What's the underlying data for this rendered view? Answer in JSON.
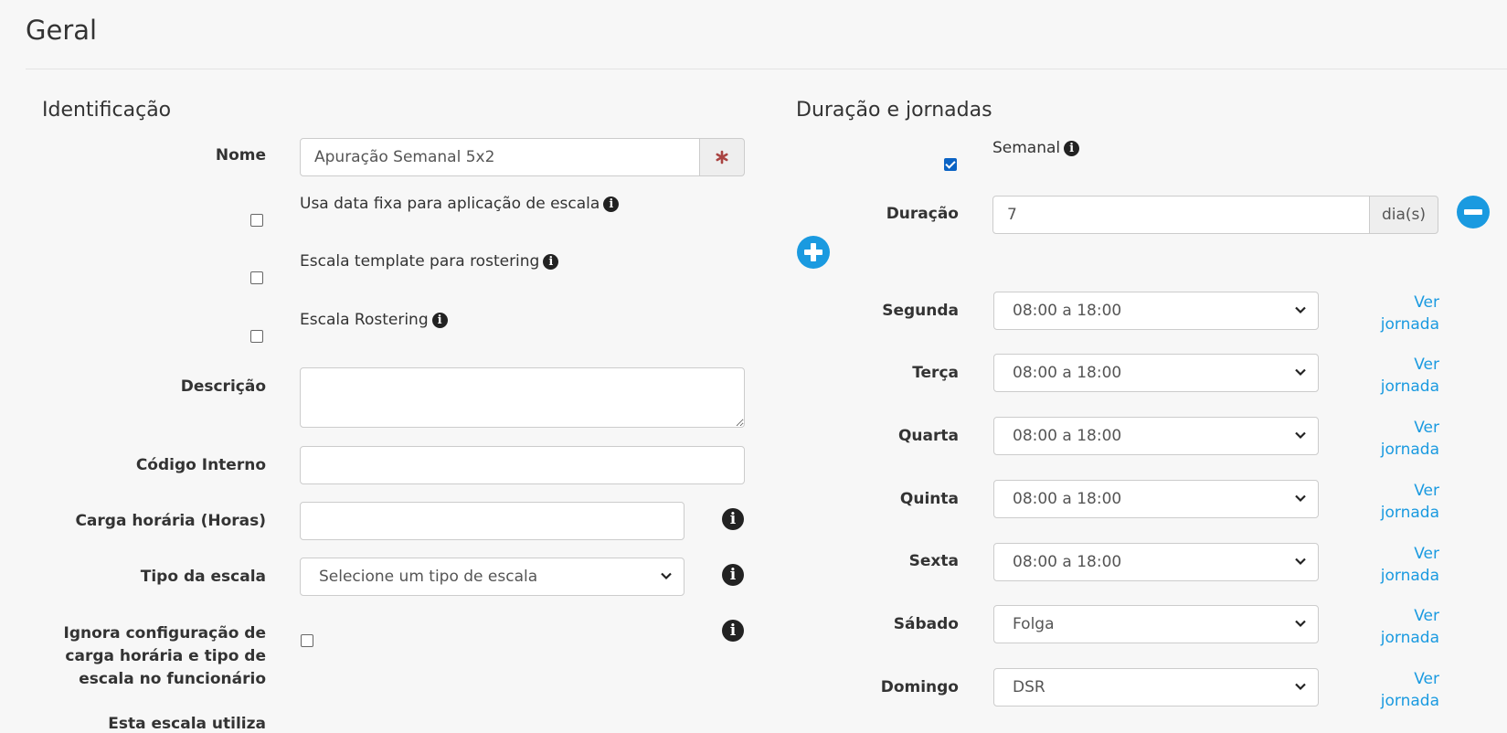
{
  "page": {
    "title": "Geral"
  },
  "identificacao": {
    "heading": "Identificação",
    "nome": {
      "label": "Nome",
      "value": "Apuração Semanal 5x2",
      "required_icon": "asterisk-icon"
    },
    "data_fixa": {
      "label": "Usa data fixa para aplicação de escala",
      "checked": false
    },
    "template_rostering": {
      "label": "Escala template para rostering",
      "checked": false
    },
    "escala_rostering": {
      "label": "Escala Rostering",
      "checked": false
    },
    "descricao": {
      "label": "Descrição",
      "value": ""
    },
    "codigo_interno": {
      "label": "Código Interno",
      "value": ""
    },
    "carga_horaria": {
      "label": "Carga horária (Horas)",
      "value": ""
    },
    "tipo_escala": {
      "label": "Tipo da escala",
      "placeholder": "Selecione um tipo de escala"
    },
    "ignora_config": {
      "label_lines": [
        "Ignora configuração de",
        "carga horária e tipo de",
        "escala no funcionário"
      ],
      "checked": false
    },
    "next_label": "Esta escala utiliza"
  },
  "duracao": {
    "heading": "Duração e jornadas",
    "semanal": {
      "label": "Semanal",
      "checked": true
    },
    "duracao": {
      "label": "Duração",
      "value": "7",
      "unit": "dia(s)"
    },
    "ver_jornada_link": [
      "Ver",
      "jornada"
    ],
    "days": [
      {
        "label": "Segunda",
        "value": "08:00 a 18:00"
      },
      {
        "label": "Terça",
        "value": "08:00 a 18:00"
      },
      {
        "label": "Quarta",
        "value": "08:00 a 18:00"
      },
      {
        "label": "Quinta",
        "value": "08:00 a 18:00"
      },
      {
        "label": "Sexta",
        "value": "08:00 a 18:00"
      },
      {
        "label": "Sábado",
        "value": "Folga"
      },
      {
        "label": "Domingo",
        "value": "DSR"
      }
    ]
  },
  "colors": {
    "accent": "#1a9ae0",
    "required": "#a94442",
    "checkbox": "#0b63c4"
  },
  "icons": {
    "info": "info-icon",
    "add": "plus-circle-icon",
    "remove": "minus-circle-icon",
    "dropdown": "chevron-down-icon"
  }
}
